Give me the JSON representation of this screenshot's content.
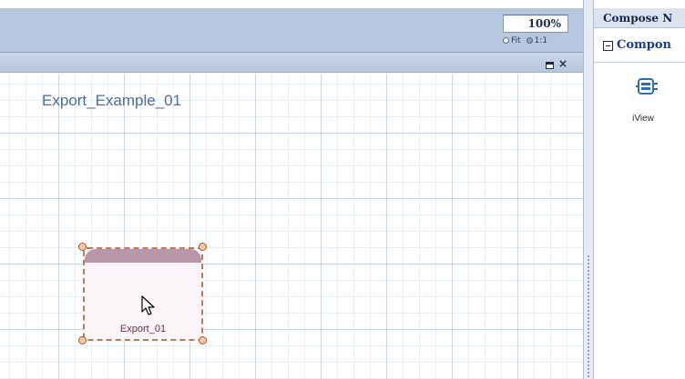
{
  "toolbar": {
    "zoom_value": "100%",
    "zoom_options": [
      {
        "label": "Fit",
        "selected": false
      },
      {
        "label": "1:1",
        "selected": true
      }
    ]
  },
  "view_header": {
    "maximize_icon": "maximize-icon",
    "close_icon": "close-icon",
    "close_glyph": "×"
  },
  "canvas": {
    "model_title": "Export_Example_01",
    "node": {
      "label": "Export_01",
      "type_icon": "iview-node"
    }
  },
  "right_panel": {
    "title": "Compose N",
    "section": "Compon",
    "tools": [
      {
        "label": "iView",
        "icon": "iview-tool-icon"
      }
    ]
  },
  "colors": {
    "toolbar_bg": "#b7c7df",
    "title_text": "#4a6da0",
    "node_border": "#c07a58",
    "node_header": "#b898a8",
    "section_text": "#1a3c8a"
  }
}
